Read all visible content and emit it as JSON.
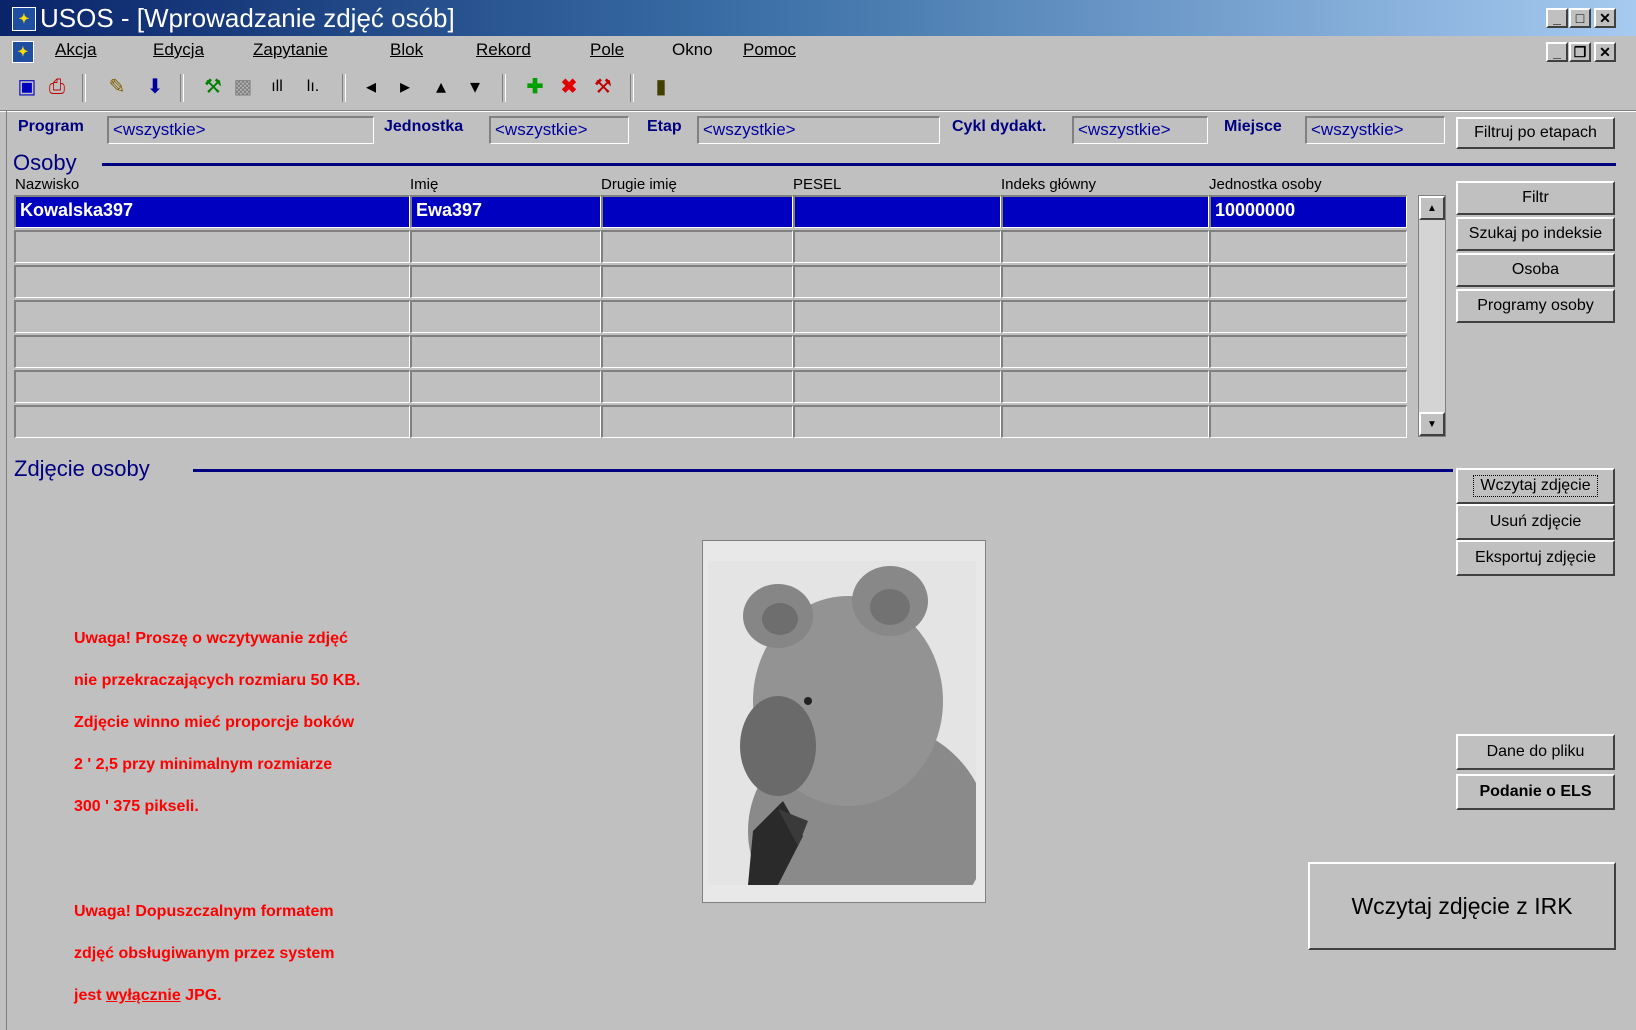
{
  "window": {
    "title": "USOS - [Wprowadzanie zdjęć osób]"
  },
  "menu": {
    "items": [
      {
        "label": "Akcja"
      },
      {
        "label": "Edycja"
      },
      {
        "label": "Zapytanie"
      },
      {
        "label": "Blok"
      },
      {
        "label": "Rekord"
      },
      {
        "label": "Pole"
      },
      {
        "label": "Okno"
      },
      {
        "label": "Pomoc"
      }
    ]
  },
  "filters": {
    "program": {
      "label": "Program",
      "value": "<wszystkie>"
    },
    "jednostka": {
      "label": "Jednostka",
      "value": "<wszystkie>"
    },
    "etap": {
      "label": "Etap",
      "value": "<wszystkie>"
    },
    "cykl": {
      "label": "Cykl dydakt.",
      "value": "<wszystkie>"
    },
    "miejsce": {
      "label": "Miejsce",
      "value": "<wszystkie>"
    },
    "filter_button": "Filtruj po etapach"
  },
  "osoby": {
    "title": "Osoby",
    "columns": [
      "Nazwisko",
      "Imię",
      "Drugie imię",
      "PESEL",
      "Indeks główny",
      "Jednostka osoby"
    ],
    "rows": [
      [
        "Kowalska397",
        "Ewa397",
        "",
        "",
        "",
        "10000000"
      ],
      [
        "",
        "",
        "",
        "",
        "",
        ""
      ],
      [
        "",
        "",
        "",
        "",
        "",
        ""
      ],
      [
        "",
        "",
        "",
        "",
        "",
        ""
      ],
      [
        "",
        "",
        "",
        "",
        "",
        ""
      ],
      [
        "",
        "",
        "",
        "",
        "",
        ""
      ],
      [
        "",
        "",
        "",
        "",
        "",
        ""
      ]
    ],
    "buttons": {
      "filtr": "Filtr",
      "szukaj": "Szukaj po indeksie",
      "osoba": "Osoba",
      "programy": "Programy osoby"
    }
  },
  "zdjecie": {
    "title": "Zdjęcie osoby",
    "buttons": {
      "wczytaj": "Wczytaj zdjęcie",
      "usun": "Usuń zdjęcie",
      "eksportuj": "Eksportuj zdjęcie",
      "dane": "Dane do pliku",
      "podanie": "Podanie o ELS",
      "irk": "Wczytaj zdjęcie z IRK"
    },
    "warning1": [
      "Uwaga! Proszę o wczytywanie zdjęć",
      "nie przekraczających rozmiaru 50 KB.",
      "Zdjęcie winno mieć proporcje boków",
      " 2 ' 2,5 przy minimalnym rozmiarze",
      "300 ' 375 pikseli."
    ],
    "warning2": {
      "line1": "Uwaga! Dopuszczalnym formatem",
      "line2": "zdjęć obsługiwanym przez system",
      "line3_pre": "jest ",
      "line3_u": "wyłącznie",
      "line3_post": " JPG."
    }
  }
}
